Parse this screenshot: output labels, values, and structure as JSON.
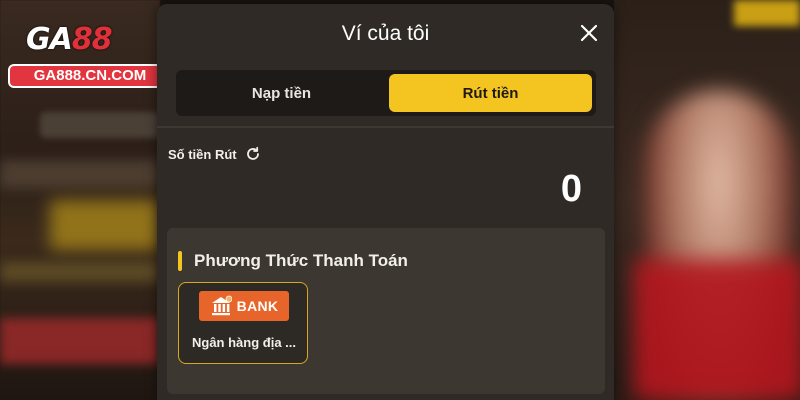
{
  "brand": {
    "logo_text_a": "GA",
    "logo_text_b": "88",
    "url_badge": "GA888.CN.COM"
  },
  "wallet": {
    "title": "Ví của tôi",
    "tabs": [
      {
        "label": "Nạp tiền",
        "active": false
      },
      {
        "label": "Rút tiền",
        "active": true
      }
    ],
    "amount_label": "Số tiền Rút",
    "amount_value": "0",
    "payment_section_title": "Phương Thức Thanh Toán",
    "methods": [
      {
        "label": "Ngân hàng địa ...",
        "logo_text": "BANK",
        "icon": "bank-icon"
      }
    ]
  },
  "colors": {
    "accent": "#f4c521",
    "modal_bg": "#2f2a25",
    "bank_orange": "#e7652a",
    "brand_red": "#e3353f"
  }
}
